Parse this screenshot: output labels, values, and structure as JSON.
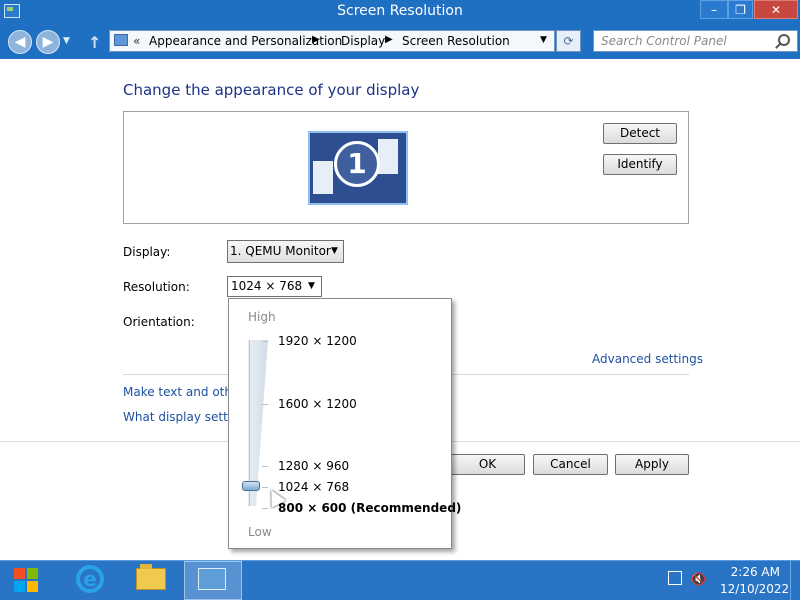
{
  "window": {
    "title": "Screen Resolution",
    "minimize_symbol": "–",
    "maximize_symbol": "❐",
    "close_symbol": "✕"
  },
  "nav": {
    "back_symbol": "◀",
    "forward_symbol": "▶",
    "recent_symbol": "▼",
    "up_symbol": "↑"
  },
  "address": {
    "overflow": "«",
    "crumbs": [
      "Appearance and Personalization",
      "Display",
      "Screen Resolution"
    ],
    "separator": "▶",
    "dropdown_symbol": "▼",
    "refresh_symbol": "⟳"
  },
  "search": {
    "placeholder": "Search Control Panel"
  },
  "content": {
    "heading": "Change the appearance of your display",
    "monitor_number": "1",
    "detect": "Detect",
    "identify": "Identify",
    "display_label": "Display:",
    "display_value": "1. QEMU Monitor",
    "resolution_label": "Resolution:",
    "resolution_value": "1024 × 768",
    "orientation_label": "Orientation:",
    "advanced_settings": "Advanced settings",
    "link_text_size": "Make text and other",
    "link_display_settings": "What display setting",
    "ok": "OK",
    "cancel": "Cancel",
    "apply": "Apply",
    "select_arrow": "▼"
  },
  "resolution_popup": {
    "high": "High",
    "low": "Low",
    "options": [
      "1920 × 1200",
      "1600 × 1200",
      "1280 × 960",
      "1024 × 768",
      "800 × 600 (Recommended)"
    ],
    "selected": "1024 × 768"
  },
  "taskbar": {
    "ie_glyph": "e",
    "volume_symbol": "🔇",
    "time": "2:26 AM",
    "date": "12/10/2022"
  },
  "colors": {
    "titlebar": "#1f6fc3",
    "taskbar": "#2a74c6",
    "heading": "#1e3287",
    "link": "#1e50a2"
  }
}
